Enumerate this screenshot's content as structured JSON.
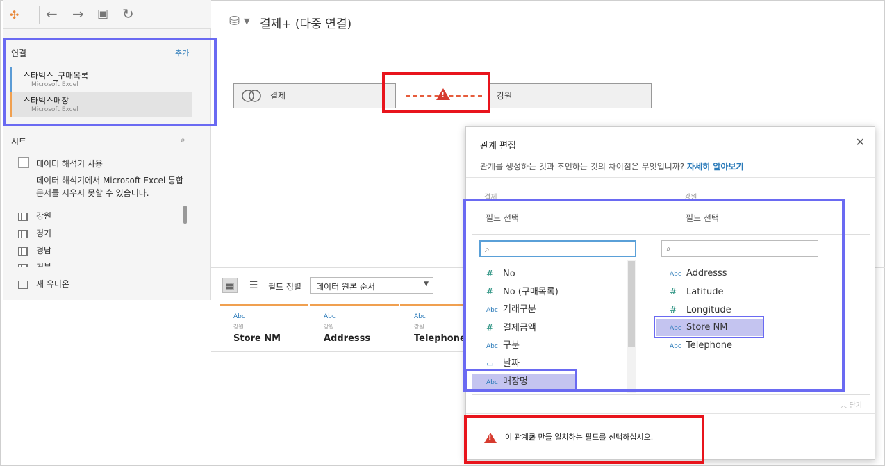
{
  "toolbar": {
    "icons": [
      "tableau-logo-icon",
      "back-arrow-icon",
      "forward-arrow-icon",
      "save-icon",
      "refresh-icon"
    ],
    "glyphs": [
      "✣",
      "←",
      "→",
      "▣",
      "↻"
    ]
  },
  "connections": {
    "label": "연결",
    "add_label": "추가",
    "items": [
      {
        "name": "스타벅스_구매목록",
        "type": "Microsoft Excel",
        "color": "#5b9bd5"
      },
      {
        "name": "스타벅스매장",
        "type": "Microsoft Excel",
        "color": "#f0a050"
      }
    ]
  },
  "sheets": {
    "label": "시트",
    "interpreter_label": "데이터 해석기 사용",
    "interpreter_desc": "데이터 해석기에서 Microsoft Excel 통합 문서를 지우지 못할 수 있습니다.",
    "items": [
      "강원",
      "경기",
      "경남",
      "경북"
    ],
    "new_union": "새 유니온"
  },
  "canvas": {
    "title": "결제+ (다중 연결)",
    "left_table": "결제",
    "right_table": "강원"
  },
  "grid": {
    "sort_label": "필드 정렬",
    "sort_value": "데이터 원본 순서",
    "columns": [
      {
        "type": "Abc",
        "source": "강원",
        "name": "Store NM"
      },
      {
        "type": "Abc",
        "source": "강원",
        "name": "Addresss"
      },
      {
        "type": "Abc",
        "source": "강원",
        "name": "Telephone"
      }
    ]
  },
  "dialog": {
    "title": "관계 편집",
    "desc": "관계를 생성하는 것과 조인하는 것의 차이점은 무엇입니까?",
    "learn_more": "자세히 알아보기",
    "left_table": "결제",
    "right_table": "강원",
    "left_select": "필드 선택",
    "right_select": "필드 선택",
    "left_fields": [
      {
        "icon": "#",
        "kind": "num",
        "name": "No"
      },
      {
        "icon": "#",
        "kind": "num",
        "name": "No (구매목록)"
      },
      {
        "icon": "Abc",
        "kind": "str",
        "name": "거래구분"
      },
      {
        "icon": "#",
        "kind": "num",
        "name": "결제금액"
      },
      {
        "icon": "Abc",
        "kind": "str",
        "name": "구분"
      },
      {
        "icon": "▭",
        "kind": "date",
        "name": "날짜"
      },
      {
        "icon": "Abc",
        "kind": "str",
        "name": "매장명"
      }
    ],
    "right_fields": [
      {
        "icon": "Abc",
        "kind": "str",
        "name": "Addresss"
      },
      {
        "icon": "#",
        "kind": "num",
        "name": "Latitude"
      },
      {
        "icon": "#",
        "kind": "num",
        "name": "Longitude"
      },
      {
        "icon": "Abc",
        "kind": "str",
        "name": "Store NM"
      },
      {
        "icon": "Abc",
        "kind": "str",
        "name": "Telephone"
      }
    ],
    "collapse_label": "닫기",
    "warning": "이 관계를 만들 일치하는 필드를 선택하십시오."
  },
  "colors": {
    "highlight_blue": "#6a6af2",
    "highlight_red": "#e8141c",
    "warning_red": "#d63a2e",
    "link_blue": "#2a7ab9"
  }
}
